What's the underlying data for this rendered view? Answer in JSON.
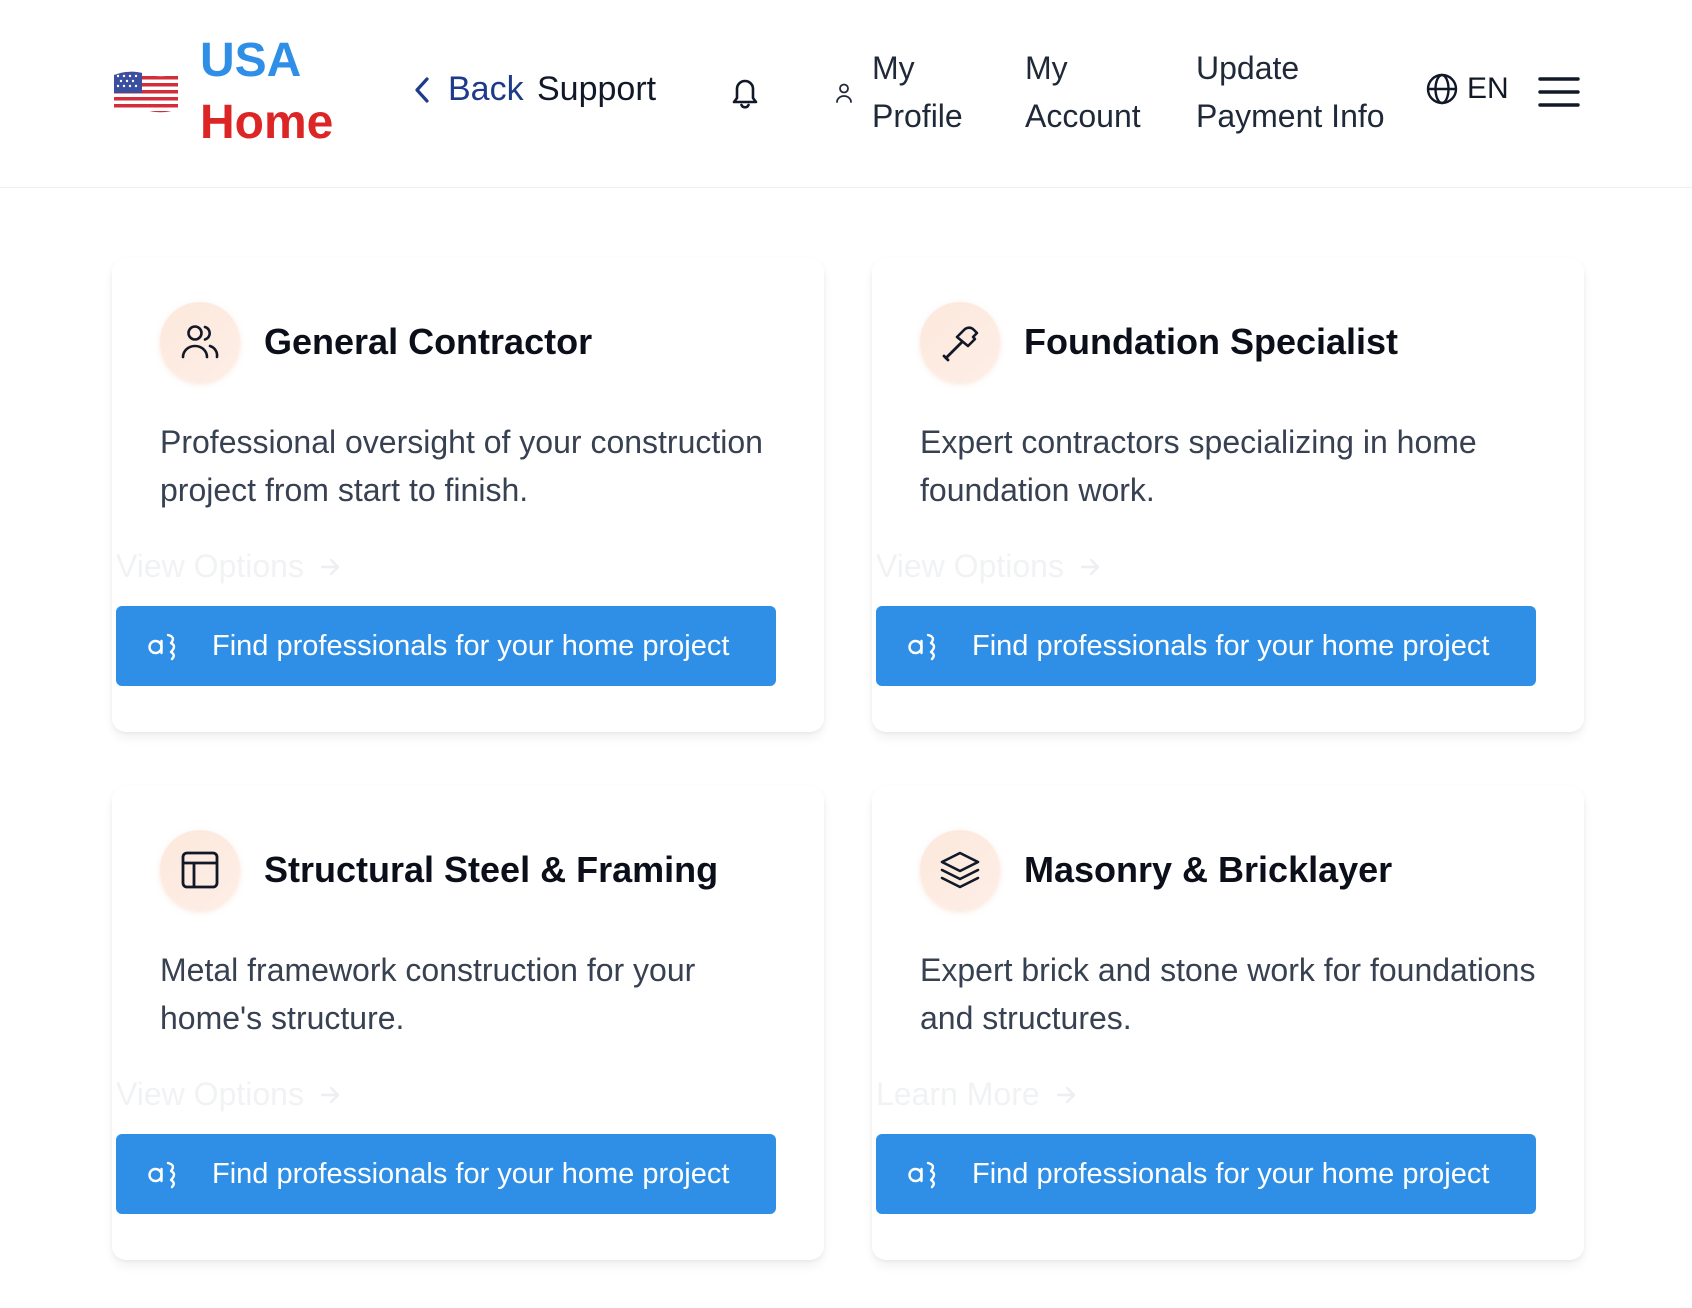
{
  "header": {
    "brand_line1": "USA",
    "brand_line2": "Home",
    "back_label": "Back",
    "support_label": "Support",
    "nav": {
      "profile_line1": "My",
      "profile_line2": "Profile",
      "account_line1": "My",
      "account_line2": "Account",
      "payment_line1": "Update",
      "payment_line2": "Payment Info"
    },
    "language": "EN",
    "icons": [
      "us-flag-icon",
      "chevron-left-icon",
      "bell-icon",
      "user-icon",
      "globe-icon",
      "hamburger-menu-icon"
    ]
  },
  "cards": [
    {
      "title": "General Contractor",
      "description": "Professional oversight of your construction project from start to finish.",
      "link": "View Options",
      "button": "Find professionals for your home project",
      "icon": "users-icon"
    },
    {
      "title": "Foundation Specialist",
      "description": "Expert contractors specializing in home foundation work.",
      "link": "View Options",
      "button": "Find professionals for your home project",
      "icon": "hammer-icon"
    },
    {
      "title": "Structural Steel & Framing",
      "description": "Metal framework construction for your home's structure.",
      "link": "View Options",
      "button": "Find professionals for your home project",
      "icon": "layout-icon"
    },
    {
      "title": "Masonry & Bricklayer",
      "description": "Expert brick and stone work for foundations and structures.",
      "link": "Learn More",
      "button": "Find professionals for your home project",
      "icon": "layers-icon"
    }
  ],
  "colors": {
    "accent": "#2f8fe6",
    "brand_blue": "#2f8fe6",
    "brand_red": "#dc2626",
    "back_link": "#1e3a8a"
  }
}
